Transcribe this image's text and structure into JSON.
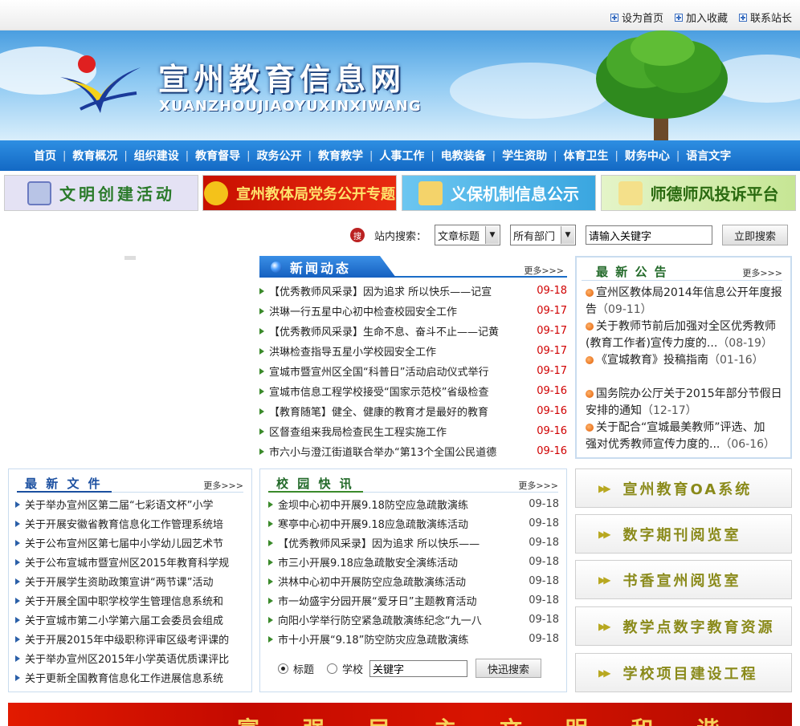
{
  "toplinks": [
    "设为首页",
    "加入收藏",
    "联系站长"
  ],
  "header": {
    "title": "宣州教育信息网",
    "subtitle": "XUANZHOUJIAOYUXINXIWANG"
  },
  "nav": [
    "首页",
    "教育概况",
    "组织建设",
    "教育督导",
    "政务公开",
    "教育教学",
    "人事工作",
    "电教装备",
    "学生资助",
    "体育卫生",
    "财务中心",
    "语言文字"
  ],
  "promos": [
    {
      "label": "文明创建活动",
      "bg": "#e2e0f3",
      "color": "#2a6a2a"
    },
    {
      "label": "宣州教体局党务公开专题",
      "bg": "#d81c10",
      "color": "#ffe36b"
    },
    {
      "label": "义保机制信息公示",
      "bg": "#4db3e8",
      "color": "#ffffff"
    },
    {
      "label": "师德师风投诉平台",
      "bg": "#cfeaa0",
      "color": "#2a6a10"
    }
  ],
  "search": {
    "icon_text": "搜",
    "label": "站内搜索：",
    "type_select": "文章标题",
    "dept_select": "所有部门",
    "input_value": "请输入关键字",
    "button": "立即搜索"
  },
  "news": {
    "title": "新闻动态",
    "more": "更多>>>",
    "items": [
      {
        "title": "【优秀教师风采录】因为追求 所以快乐——记宣",
        "date": "09-18"
      },
      {
        "title": "洪琳一行五星中心初中检查校园安全工作",
        "date": "09-17"
      },
      {
        "title": "【优秀教师风采录】生命不息、奋斗不止——记黄",
        "date": "09-17"
      },
      {
        "title": "洪琳检查指导五星小学校园安全工作",
        "date": "09-17"
      },
      {
        "title": "宣城市暨宣州区全国“科普日”活动启动仪式举行",
        "date": "09-17"
      },
      {
        "title": "宣城市信息工程学校接受“国家示范校”省级检查",
        "date": "09-16"
      },
      {
        "title": "【教育随笔】健全、健康的教育才是最好的教育",
        "date": "09-16"
      },
      {
        "title": "区督查组来我局检查民生工程实施工作",
        "date": "09-16"
      },
      {
        "title": "市六小与澄江街道联合举办“第13个全国公民道德",
        "date": "09-16"
      }
    ]
  },
  "notice": {
    "title": "最 新 公 告",
    "more": "更多>>>",
    "items": [
      {
        "line1": "宣州区教体局2014年信息公开年度报",
        "line2": "告",
        "date": "（09-11）"
      },
      {
        "line1": "关于教师节前后加强对全区优秀教师",
        "line2": "(教育工作者)宣传力度的...",
        "date": "（08-19）"
      },
      {
        "line1": "《宣城教育》投稿指南",
        "line2": "",
        "date": "（01-16）"
      },
      {
        "line1": "国务院办公厅关于2015年部分节假日",
        "line2": "安排的通知",
        "date": "（12-17）"
      },
      {
        "line1": "关于配合“宣城最美教师”评选、加",
        "line2": "强对优秀教师宣传力度的...",
        "date": "（06-16）"
      }
    ]
  },
  "files": {
    "title": "最 新 文 件",
    "more": "更多>>>",
    "items": [
      "关于举办宣州区第二届“七彩语文杯”小学",
      "关于开展安徽省教育信息化工作管理系统培",
      "关于公布宣州区第七届中小学幼儿园艺术节",
      "关于公布宣城市暨宣州区2015年教育科学规",
      "关于开展学生资助政策宣讲“两节课”活动",
      "关于开展全国中职学校学生管理信息系统和",
      "关于宣城市第二小学第六届工会委员会组成",
      "关于开展2015年中级职称评审区级考评课的",
      "关于举办宣州区2015年小学英语优质课评比",
      "关于更新全国教育信息化工作进展信息系统"
    ]
  },
  "campus": {
    "title": "校 园 快 讯",
    "more": "更多>>>",
    "items": [
      {
        "title": "金坝中心初中开展9.18防空应急疏散演练",
        "date": "09-18"
      },
      {
        "title": "寒亭中心初中开展9.18应急疏散演练活动",
        "date": "09-18"
      },
      {
        "title": "【优秀教师风采录】因为追求 所以快乐——",
        "date": "09-18"
      },
      {
        "title": "市三小开展9.18应急疏散安全演练活动",
        "date": "09-18"
      },
      {
        "title": "洪林中心初中开展防空应急疏散演练活动",
        "date": "09-18"
      },
      {
        "title": "市一幼盛宇分园开展“爱牙日”主题教育活动",
        "date": "09-18"
      },
      {
        "title": "向阳小学举行防空紧急疏散演练纪念“九一八",
        "date": "09-18"
      },
      {
        "title": "市十小开展“9.18”防空防灾应急疏散演练",
        "date": "09-18"
      }
    ],
    "radio1": "标题",
    "radio2": "学校",
    "keyword": "关键字",
    "quick_button": "快迅搜索"
  },
  "side_buttons": [
    "宣州教育OA系统",
    "数字期刊阅览室",
    "书香宣州阅览室",
    "教学点数字教育资源",
    "学校项目建设工程"
  ],
  "footer": {
    "slogan": "富 强 民 主 文 明 和 谐"
  },
  "colors": {
    "nav_bg": "#1a78d2",
    "date_red": "#d00000",
    "panel_border": "#c9dcef",
    "title_blue": "#1b4fa0"
  }
}
